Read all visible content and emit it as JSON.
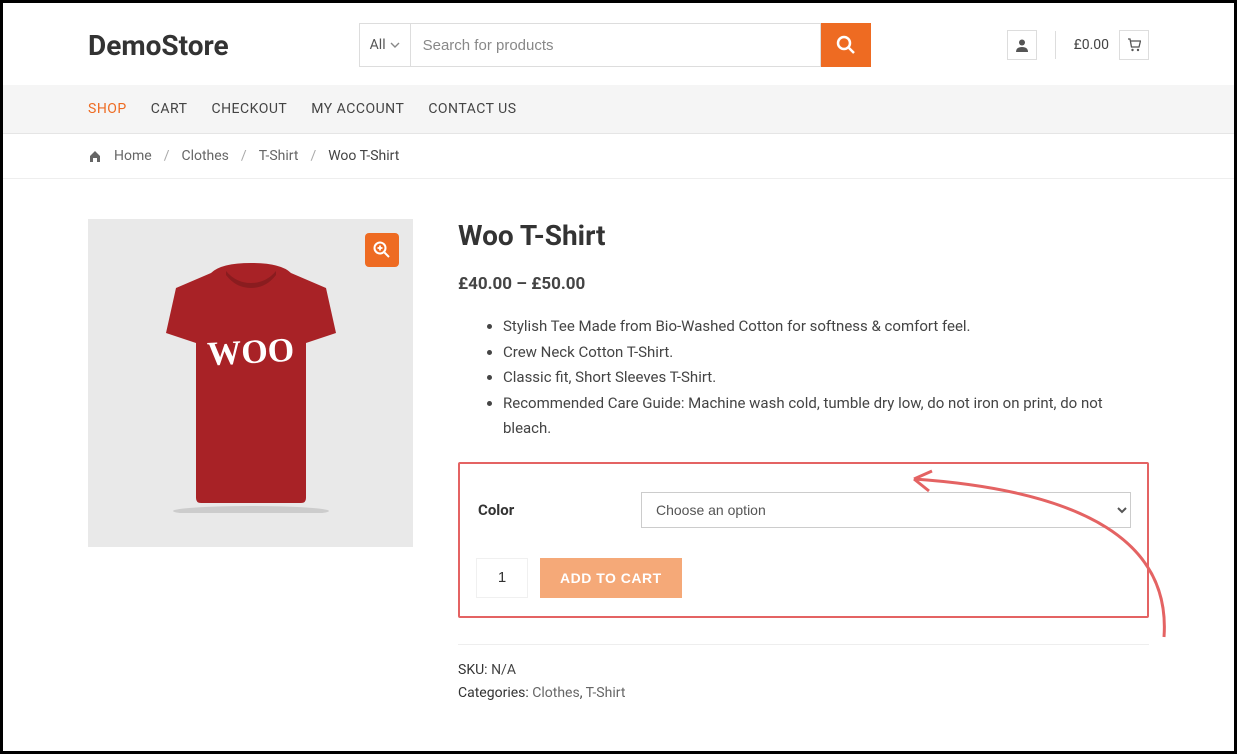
{
  "header": {
    "logo": "DemoStore",
    "category_label": "All",
    "search_placeholder": "Search for products",
    "cart_total": "£0.00"
  },
  "nav": {
    "items": [
      "SHOP",
      "CART",
      "CHECKOUT",
      "MY ACCOUNT",
      "CONTACT US"
    ]
  },
  "breadcrumb": {
    "home": "Home",
    "cat1": "Clothes",
    "cat2": "T-Shirt",
    "current": "Woo T-Shirt"
  },
  "product": {
    "title": "Woo T-Shirt",
    "price": "£40.00 – £50.00",
    "bullets": [
      "Stylish Tee Made from Bio-Washed Cotton for softness & comfort feel.",
      "Crew Neck Cotton T-Shirt.",
      "Classic fit, Short Sleeves T-Shirt.",
      "Recommended Care Guide: Machine wash cold, tumble dry low, do not iron on print, do not bleach."
    ],
    "variation_label": "Color",
    "variation_option": "Choose an option",
    "qty": "1",
    "add_to_cart": "ADD TO CART",
    "sku_label": "SKU:",
    "sku_value": "N/A",
    "categories_label": "Categories:",
    "category1": "Clothes",
    "category2": "T-Shirt"
  },
  "colors": {
    "accent": "#ee6b22",
    "highlight_border": "#e46363"
  }
}
